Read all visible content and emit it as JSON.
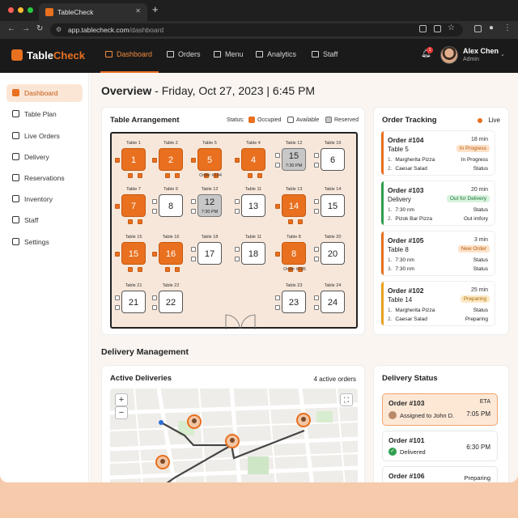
{
  "browser": {
    "tab_title": "TableCheck",
    "url_domain": "app.tablecheck.com",
    "url_path": "/dashboard"
  },
  "header": {
    "brand_left": "Table",
    "brand_right": "Check",
    "nav": [
      {
        "label": "Dashboard",
        "icon": "dashboard-icon",
        "active": true
      },
      {
        "label": "Orders",
        "icon": "cart-icon",
        "active": false
      },
      {
        "label": "Menu",
        "icon": "book-icon",
        "active": false
      },
      {
        "label": "Analytics",
        "icon": "bar-chart-icon",
        "active": false
      },
      {
        "label": "Staff",
        "icon": "people-icon",
        "active": false
      }
    ],
    "notifications": "1",
    "user_name": "Alex Chen",
    "user_role": "Admin"
  },
  "sidebar": {
    "items": [
      {
        "label": "Dashboard",
        "icon": "dashboard-icon",
        "active": true
      },
      {
        "label": "Table Plan",
        "icon": "grid-icon",
        "active": false
      },
      {
        "label": "Live Orders",
        "icon": "cart-icon",
        "active": false
      },
      {
        "label": "Delivery",
        "icon": "truck-icon",
        "active": false
      },
      {
        "label": "Reservations",
        "icon": "calendar-icon",
        "active": false
      },
      {
        "label": "Inventory",
        "icon": "bag-icon",
        "active": false
      },
      {
        "label": "Staff",
        "icon": "people-icon",
        "active": false
      },
      {
        "label": "Settings",
        "icon": "gear-icon",
        "active": false
      }
    ]
  },
  "overview": {
    "prefix": "Overview",
    "date": " - Friday, Oct 27, 2023 | 6:45 PM"
  },
  "table_arrangement": {
    "title": "Table Arrangement",
    "status_label": "Status:",
    "legend": {
      "occupied": "Occupied",
      "available": "Available",
      "reserved": "Reserved"
    },
    "tables": [
      {
        "label": "Table 1",
        "num": "1",
        "state": "occupied"
      },
      {
        "label": "Table 2",
        "num": "2",
        "state": "occupied"
      },
      {
        "label": "Table 5",
        "num": "5",
        "state": "occupied",
        "note": "Order #104"
      },
      {
        "label": "Table 4",
        "num": "4",
        "state": "occupied"
      },
      {
        "label": "Table 12",
        "num": "15",
        "state": "reserved",
        "time": "7:30 PM"
      },
      {
        "label": "Table 16",
        "num": "6",
        "state": "available"
      },
      {
        "label": "Table 7",
        "num": "7",
        "state": "occupied"
      },
      {
        "label": "Table 9",
        "num": "8",
        "state": "available"
      },
      {
        "label": "Table 12",
        "num": "12",
        "state": "reserved",
        "time": "7:30 PM"
      },
      {
        "label": "Table 11",
        "num": "13",
        "state": "available"
      },
      {
        "label": "Table 13",
        "num": "14",
        "state": "occupied"
      },
      {
        "label": "Table 14",
        "num": "15",
        "state": "available"
      },
      {
        "label": "Table 15",
        "num": "15",
        "state": "occupied"
      },
      {
        "label": "Table 16",
        "num": "16",
        "state": "occupied"
      },
      {
        "label": "Table 18",
        "num": "17",
        "state": "available"
      },
      {
        "label": "Table 11",
        "num": "18",
        "state": "available"
      },
      {
        "label": "Table 8",
        "num": "8",
        "state": "occupied",
        "note": "Order #105"
      },
      {
        "label": "Table 20",
        "num": "20",
        "state": "available"
      },
      {
        "label": "Table 21",
        "num": "21",
        "state": "available"
      },
      {
        "label": "Table 22",
        "num": "22",
        "state": "available"
      },
      {
        "label": "Table 23",
        "num": "23",
        "state": "available"
      },
      {
        "label": "Table 24",
        "num": "24",
        "state": "available"
      }
    ]
  },
  "order_tracking": {
    "title": "Order Tracking",
    "live": "Live",
    "orders": [
      {
        "id": "Order #104",
        "mins": "18 min",
        "table": "Table 5",
        "status": "In Progress",
        "accent": "#e8701f",
        "badge_bg": "#fde2c8",
        "badge_fg": "#b65a12",
        "lines": [
          {
            "n": "1.",
            "item": "Margherita Pizza",
            "stat": "In Progress"
          },
          {
            "n": "2.",
            "item": "Caesar Salad",
            "stat": "Status"
          }
        ]
      },
      {
        "id": "Order #103",
        "mins": "20 min",
        "table": "Delivery",
        "status": "Out for Delivery",
        "accent": "#2e9e4f",
        "badge_bg": "#d8f2dd",
        "badge_fg": "#1f7a3a",
        "lines": [
          {
            "n": "1.",
            "item": "7:30 nm",
            "stat": "Status"
          },
          {
            "n": "2.",
            "item": "Pizok Bar Pizza",
            "stat": "Out imfory"
          }
        ]
      },
      {
        "id": "Order #105",
        "mins": "3 min",
        "table": "Table 8",
        "status": "New Order",
        "accent": "#e8701f",
        "badge_bg": "#fde2c8",
        "badge_fg": "#b65a12",
        "lines": [
          {
            "n": "1.",
            "item": "7:30 nm",
            "stat": "Status"
          },
          {
            "n": "3.",
            "item": "7:30 nm",
            "stat": "Status"
          }
        ]
      },
      {
        "id": "Order #102",
        "mins": "25 min",
        "table": "Table 14",
        "status": "Preparing",
        "accent": "#e8a21f",
        "badge_bg": "#fde9c4",
        "badge_fg": "#a66a0b",
        "lines": [
          {
            "n": "1.",
            "item": "Margherita Pizza",
            "stat": "Status"
          },
          {
            "n": "2.",
            "item": "Caesar Salad",
            "stat": "Preparing"
          }
        ]
      }
    ]
  },
  "delivery": {
    "section_title": "Delivery Management",
    "active_title": "Active Deliveries",
    "active_count": "4 active orders",
    "status_title": "Delivery Status",
    "statuses": [
      {
        "id": "Order #103",
        "right_top": "ETA",
        "right": "7:05 PM",
        "sub": "Assigned to John D."
      },
      {
        "id": "Order #101",
        "right": "6:30 PM",
        "sub": "Delivered"
      },
      {
        "id": "Order #106",
        "right": "Preparing"
      }
    ]
  }
}
